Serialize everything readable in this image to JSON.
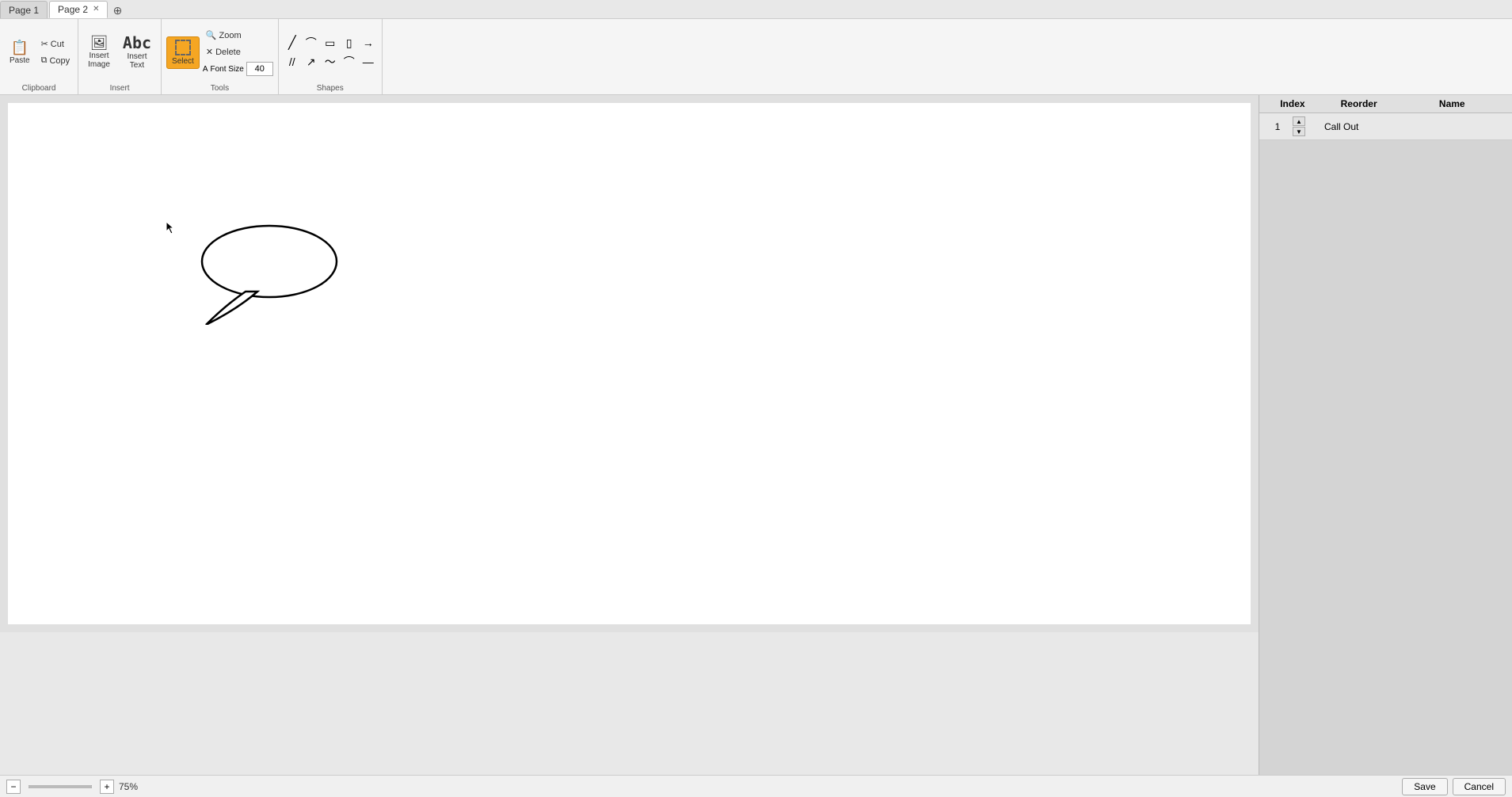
{
  "tabs": [
    {
      "label": "Page 1",
      "active": false,
      "closable": false
    },
    {
      "label": "Page 2",
      "active": true,
      "closable": true
    }
  ],
  "toolbar": {
    "sections": {
      "clipboard": {
        "label": "Clipboard",
        "paste_label": "Paste",
        "cut_label": "Cut",
        "copy_label": "Copy"
      },
      "insert": {
        "label": "Insert",
        "insert_image_label": "Insert\nImage",
        "insert_text_label": "Insert\nText"
      },
      "tools": {
        "label": "Tools",
        "select_label": "Select",
        "zoom_label": "Zoom",
        "delete_label": "Delete",
        "font_size_label": "Font Size",
        "font_size_value": "40"
      },
      "shapes": {
        "label": "Shapes",
        "shapes": [
          "╱",
          "⌒",
          "▭",
          "▯",
          "→",
          "╱╱",
          "↗",
          "〜",
          "⌒",
          "—"
        ]
      }
    }
  },
  "canvas": {
    "speech_bubble": {
      "visible": true
    }
  },
  "right_panel": {
    "headers": [
      "Index",
      "Reorder",
      "Name"
    ],
    "rows": [
      {
        "index": "1",
        "name": "Call Out"
      }
    ]
  },
  "bottom_bar": {
    "zoom_level": "75%",
    "save_label": "Save",
    "cancel_label": "Cancel"
  }
}
